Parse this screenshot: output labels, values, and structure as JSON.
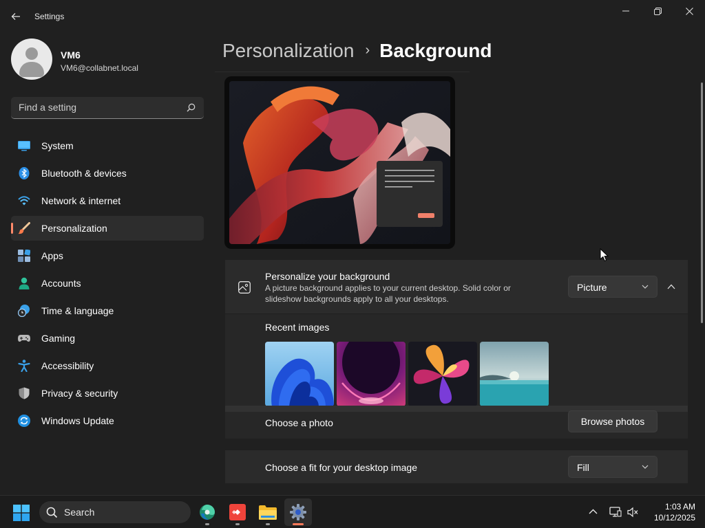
{
  "window": {
    "title": "Settings",
    "controls": {
      "minimize": "minimize-icon",
      "restore": "restore-icon",
      "close": "close-icon"
    }
  },
  "user": {
    "name": "VM6",
    "email": "VM6@collabnet.local"
  },
  "search": {
    "placeholder": "Find a setting"
  },
  "sidebar": {
    "items": [
      {
        "label": "System",
        "icon": "system-icon",
        "active": false
      },
      {
        "label": "Bluetooth & devices",
        "icon": "bluetooth-icon",
        "active": false
      },
      {
        "label": "Network & internet",
        "icon": "wifi-icon",
        "active": false
      },
      {
        "label": "Personalization",
        "icon": "brush-icon",
        "active": true
      },
      {
        "label": "Apps",
        "icon": "apps-icon",
        "active": false
      },
      {
        "label": "Accounts",
        "icon": "accounts-icon",
        "active": false
      },
      {
        "label": "Time & language",
        "icon": "clock-globe-icon",
        "active": false
      },
      {
        "label": "Gaming",
        "icon": "gamepad-icon",
        "active": false
      },
      {
        "label": "Accessibility",
        "icon": "accessibility-icon",
        "active": false
      },
      {
        "label": "Privacy & security",
        "icon": "shield-icon",
        "active": false
      },
      {
        "label": "Windows Update",
        "icon": "update-icon",
        "active": false
      }
    ]
  },
  "breadcrumb": {
    "parent": "Personalization",
    "separator": "›",
    "current": "Background"
  },
  "background": {
    "title": "Personalize your background",
    "description": "A picture background applies to your current desktop. Solid color or slideshow backgrounds apply to all your desktops.",
    "type_value": "Picture",
    "recent_label": "Recent images",
    "recent_images": [
      "bloom-blue-thumbnail",
      "purple-glow-thumbnail",
      "colorful-flower-thumbnail",
      "lake-landscape-thumbnail"
    ],
    "choose_photo_label": "Choose a photo",
    "browse_label": "Browse photos",
    "fit_label": "Choose a fit for your desktop image",
    "fit_value": "Fill"
  },
  "taskbar": {
    "search_label": "Search",
    "apps": [
      "edge-icon",
      "anydesk-icon",
      "file-explorer-icon",
      "settings-gear-icon"
    ],
    "time": "1:03 AM",
    "date": "10/12/2025"
  },
  "colors": {
    "accent": "#ff8a6a",
    "window_bg": "#202020",
    "card_bg": "#2b2b2b"
  }
}
